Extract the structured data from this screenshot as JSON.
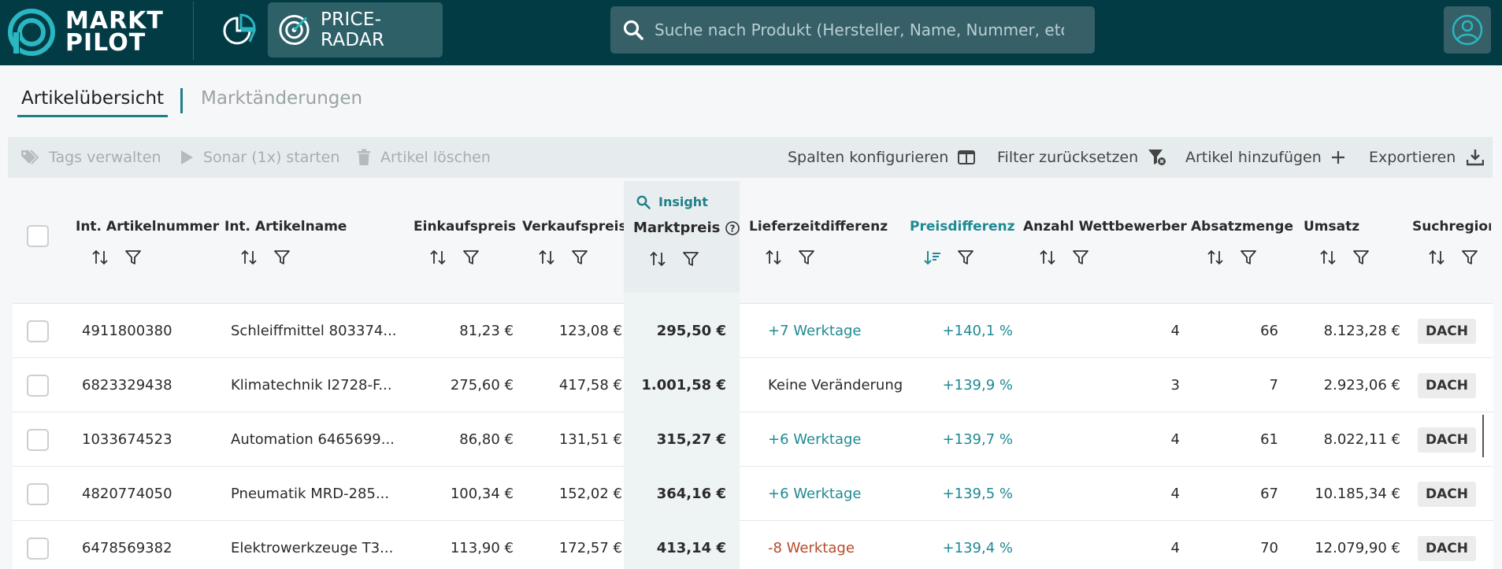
{
  "header": {
    "logo_line1": "MARKT",
    "logo_line2": "PILOT",
    "nav_price_radar": "PRICE-RADAR",
    "search_placeholder": "Suche nach Produkt (Hersteller, Name, Nummer, etc.)"
  },
  "tabs": [
    {
      "label": "Artikelübersicht",
      "active": true
    },
    {
      "label": "Marktänderungen",
      "active": false
    }
  ],
  "toolbar": {
    "tags": "Tags verwalten",
    "sonar": "Sonar (1x) starten",
    "delete": "Artikel löschen",
    "columns": "Spalten konfigurieren",
    "reset_filter": "Filter zurücksetzen",
    "add": "Artikel hinzufügen",
    "export": "Exportieren"
  },
  "table": {
    "insight_label": "Insight",
    "columns": {
      "artnr": "Int. Artikelnummer",
      "artname": "Int. Artikelname",
      "ek": "Einkaufspreis",
      "vk": "Verkaufspreis",
      "mp": "Marktpreis",
      "lzd": "Lieferzeitdifferenz",
      "pd": "Preisdifferenz",
      "wett": "Anzahl Wettbewerber",
      "abs": "Absatzmenge",
      "ums": "Umsatz",
      "reg": "Suchregion"
    },
    "rows": [
      {
        "artnr": "4911800380",
        "artname": "Schleiffmittel 803374...",
        "ek": "81,23 €",
        "vk": "123,08 €",
        "mp": "295,50 €",
        "lzd": "+7 Werktage",
        "lzd_type": "teal",
        "pd": "+140,1 %",
        "wett": "4",
        "abs": "66",
        "ums": "8.123,28 €",
        "reg": "DACH"
      },
      {
        "artnr": "6823329438",
        "artname": "Klimatechnik I2728-F...",
        "ek": "275,60 €",
        "vk": "417,58 €",
        "mp": "1.001,58 €",
        "lzd": "Keine Veränderung",
        "lzd_type": "plain",
        "pd": "+139,9 %",
        "wett": "3",
        "abs": "7",
        "ums": "2.923,06 €",
        "reg": "DACH"
      },
      {
        "artnr": "1033674523",
        "artname": "Automation 6465699...",
        "ek": "86,80 €",
        "vk": "131,51 €",
        "mp": "315,27 €",
        "lzd": "+6 Werktage",
        "lzd_type": "teal",
        "pd": "+139,7 %",
        "wett": "4",
        "abs": "61",
        "ums": "8.022,11 €",
        "reg": "DACH"
      },
      {
        "artnr": "4820774050",
        "artname": "Pneumatik MRD-285...",
        "ek": "100,34 €",
        "vk": "152,02 €",
        "mp": "364,16 €",
        "lzd": "+6 Werktage",
        "lzd_type": "teal",
        "pd": "+139,5 %",
        "wett": "4",
        "abs": "67",
        "ums": "10.185,34 €",
        "reg": "DACH"
      },
      {
        "artnr": "6478569382",
        "artname": "Elektrowerkzeuge T3...",
        "ek": "113,90 €",
        "vk": "172,57 €",
        "mp": "413,14 €",
        "lzd": "-8 Werktage",
        "lzd_type": "red",
        "pd": "+139,4 %",
        "wett": "4",
        "abs": "70",
        "ums": "12.079,90 €",
        "reg": "DACH"
      }
    ]
  },
  "colors": {
    "header_bg": "#033b45",
    "accent": "#1e7f89",
    "negative": "#b34a2a"
  }
}
